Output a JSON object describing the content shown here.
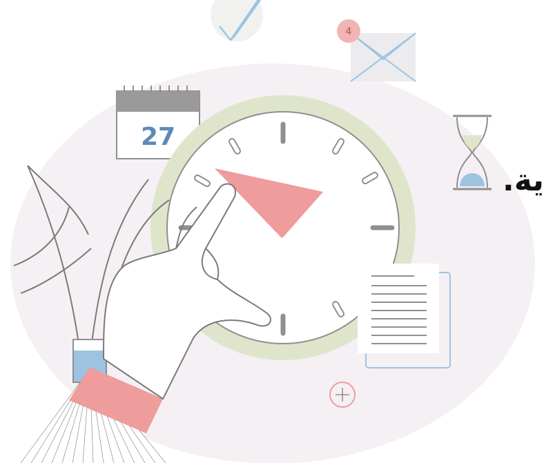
{
  "illustration": {
    "calendar_day": "27",
    "mail_badge_count": "4",
    "arabic_fragments": [
      "ية."
    ]
  },
  "colors": {
    "background_blob": "#f5f0f4",
    "clock_ring": "#dfe5cb",
    "clock_hands": "#ee9c9c",
    "clock_ticks": "#8f8f8f",
    "wristband": "#ee9c9c",
    "line_art": "#7a7a7a",
    "accent_blue": "#9ec3e0",
    "hourglass_sand_top": "#dfe5cb",
    "hourglass_sand_bottom": "#9ec3e0"
  },
  "icons": [
    "checkmark-icon",
    "envelope-icon",
    "calendar-icon",
    "hourglass-icon",
    "clock-icon",
    "document-icon",
    "plus-circle-icon",
    "plant-icon",
    "hand-icon",
    "glass-icon"
  ]
}
